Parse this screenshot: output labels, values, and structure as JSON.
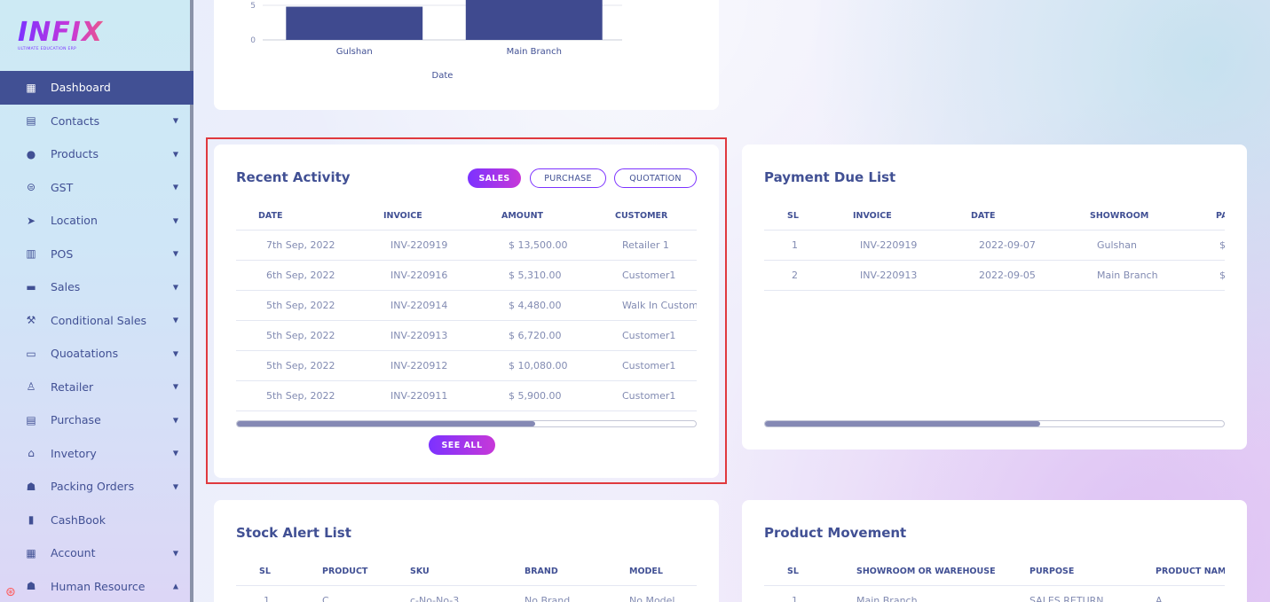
{
  "brand": {
    "logo_text": "INFIX",
    "logo_sub": "ULTIMATE EDUCATION ERP"
  },
  "sidebar": {
    "items": [
      {
        "label": "Dashboard",
        "icon": "grid-icon",
        "active": true,
        "caret": ""
      },
      {
        "label": "Contacts",
        "icon": "contact-book-icon",
        "caret": "▼"
      },
      {
        "label": "Products",
        "icon": "product-circle-icon",
        "caret": "▼"
      },
      {
        "label": "GST",
        "icon": "tax-icon",
        "caret": "▼"
      },
      {
        "label": "Location",
        "icon": "location-arrow-icon",
        "caret": "▼"
      },
      {
        "label": "POS",
        "icon": "pos-icon",
        "caret": "▼"
      },
      {
        "label": "Sales",
        "icon": "sales-box-icon",
        "caret": "▼"
      },
      {
        "label": "Conditional Sales",
        "icon": "hammer-icon",
        "caret": "▼"
      },
      {
        "label": "Quoatations",
        "icon": "quotation-icon",
        "caret": "▼"
      },
      {
        "label": "Retailer",
        "icon": "retailer-icon",
        "caret": "▼"
      },
      {
        "label": "Purchase",
        "icon": "store-icon",
        "caret": "▼"
      },
      {
        "label": "Invetory",
        "icon": "bank-icon",
        "caret": "▼"
      },
      {
        "label": "Packing Orders",
        "icon": "users-icon",
        "caret": "▼"
      },
      {
        "label": "CashBook",
        "icon": "cashbook-icon",
        "caret": ""
      },
      {
        "label": "Account",
        "icon": "calculator-icon",
        "caret": "▼"
      },
      {
        "label": "Human Resource",
        "icon": "human-resource-icon",
        "caret": "▲"
      }
    ]
  },
  "chart": {
    "chart_data": {
      "type": "bar",
      "categories": [
        "Gulshan",
        "Main Branch"
      ],
      "values": [
        4.8,
        5.8
      ],
      "xlabel": "Date",
      "y_ticks": [
        "0",
        "5"
      ],
      "color": "#3f4a8f"
    }
  },
  "recent": {
    "title": "Recent Activity",
    "tabs": [
      "SALES",
      "PURCHASE",
      "QUOTATION"
    ],
    "headers": [
      "DATE",
      "INVOICE",
      "AMOUNT",
      "CUSTOMER"
    ],
    "rows": [
      [
        "7th Sep, 2022",
        "INV-220919",
        "$ 13,500.00",
        "Retailer 1"
      ],
      [
        "6th Sep, 2022",
        "INV-220916",
        "$ 5,310.00",
        "Customer1"
      ],
      [
        "5th Sep, 2022",
        "INV-220914",
        "$ 4,480.00",
        "Walk In Customer"
      ],
      [
        "5th Sep, 2022",
        "INV-220913",
        "$ 6,720.00",
        "Customer1"
      ],
      [
        "5th Sep, 2022",
        "INV-220912",
        "$ 10,080.00",
        "Customer1"
      ],
      [
        "5th Sep, 2022",
        "INV-220911",
        "$ 5,900.00",
        "Customer1"
      ]
    ],
    "scroll_fraction": 0.65,
    "see_all": "SEE ALL"
  },
  "payment": {
    "title": "Payment Due List",
    "headers": [
      "SL",
      "INVOICE",
      "DATE",
      "SHOWROOM",
      "PAYMENT"
    ],
    "rows": [
      [
        "1",
        "INV-220919",
        "2022-09-07",
        "Gulshan",
        "$"
      ],
      [
        "2",
        "INV-220913",
        "2022-09-05",
        "Main Branch",
        "$"
      ]
    ],
    "scroll_fraction": 0.6
  },
  "stock": {
    "title": "Stock Alert List",
    "headers": [
      "SL",
      "PRODUCT",
      "SKU",
      "BRAND",
      "MODEL"
    ],
    "rows": [
      [
        "1",
        "C",
        "c-No-No-3",
        "No Brand",
        "No Model"
      ]
    ]
  },
  "movement": {
    "title": "Product Movement",
    "headers": [
      "SL",
      "SHOWROOM OR WAREHOUSE",
      "PURPOSE",
      "PRODUCT NAME"
    ],
    "rows": [
      [
        "1",
        "Main Branch",
        "SALES RETURN",
        "A"
      ]
    ]
  }
}
